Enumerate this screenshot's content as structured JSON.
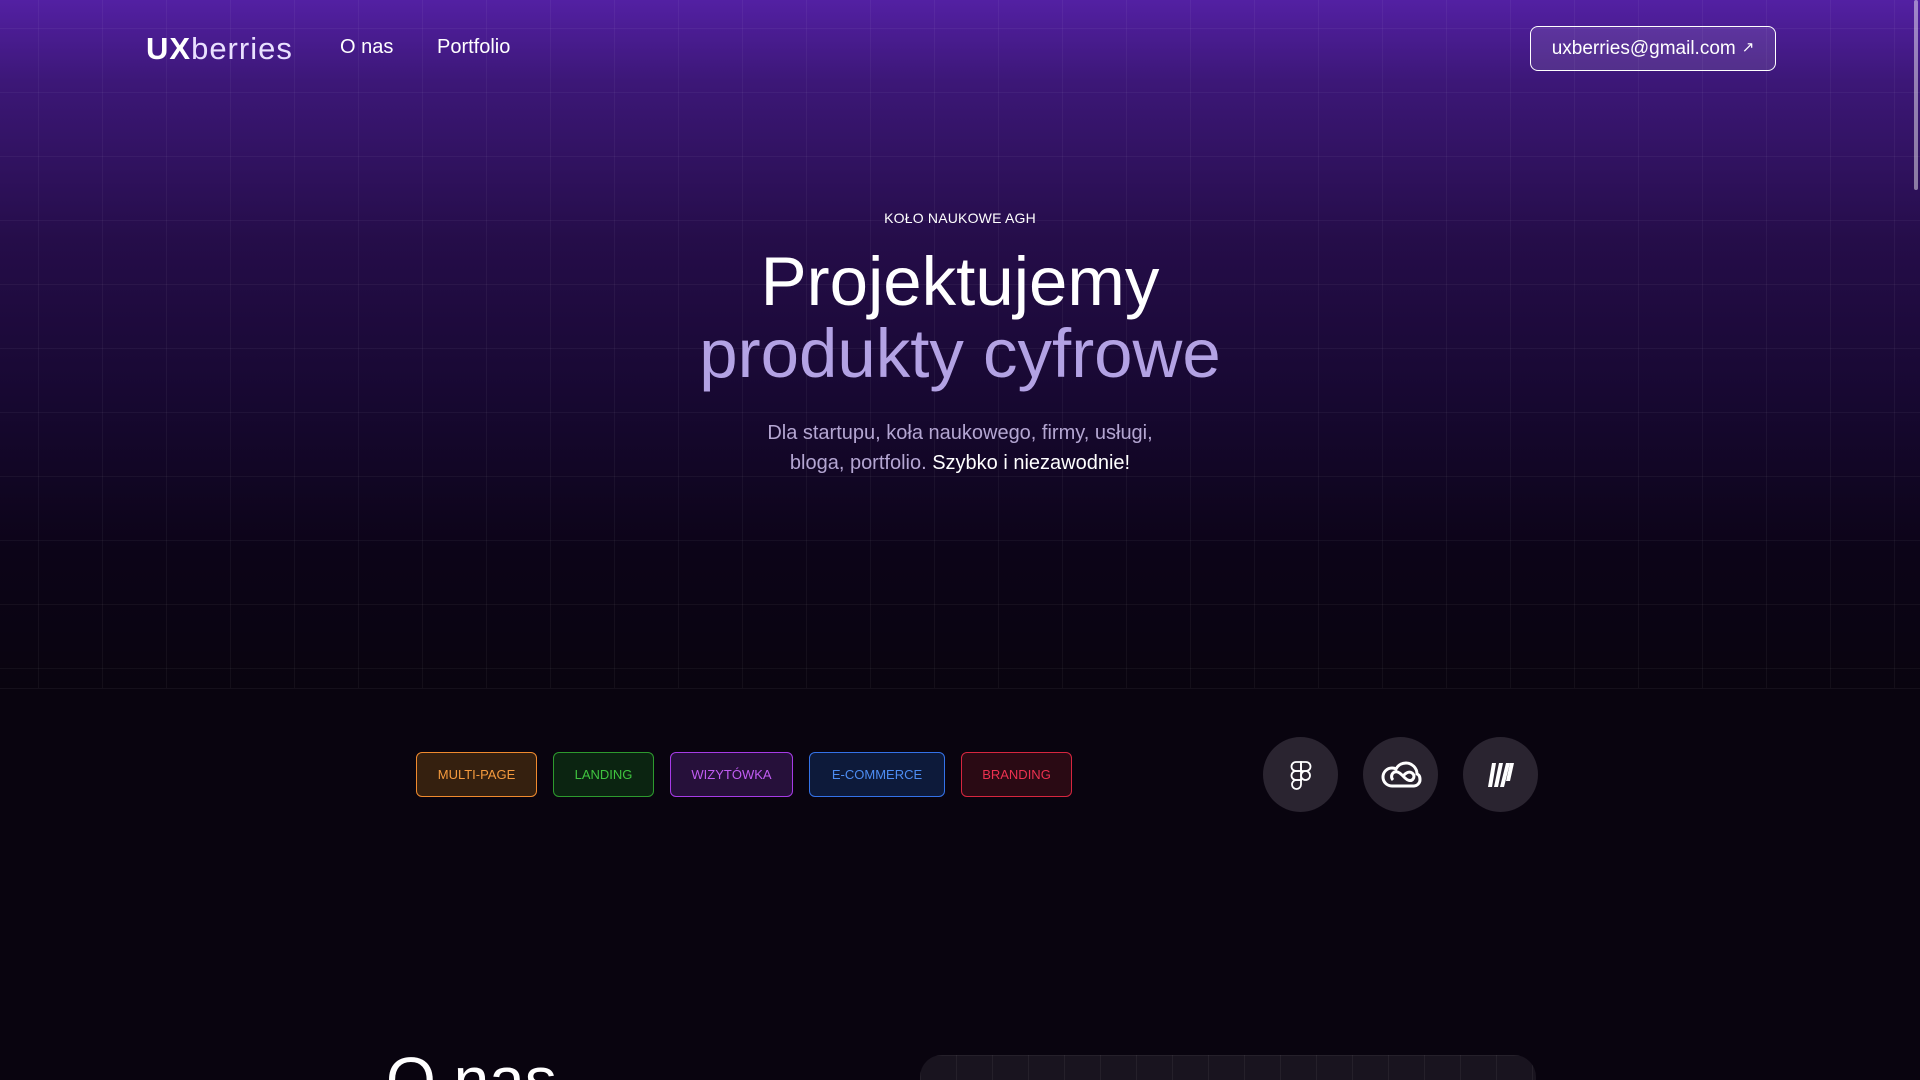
{
  "nav": {
    "logo_ux": "UX",
    "logo_berries": "berries",
    "links": [
      {
        "label": "O nas"
      },
      {
        "label": "Portfolio"
      }
    ],
    "email_label": "uxberries@gmail.com",
    "email_arrow": "↗"
  },
  "hero": {
    "eyebrow": "KOŁO NAUKOWE AGH",
    "title_line1": "Projektujemy",
    "title_line2": "produkty cyfrowe",
    "subtitle_line1": "Dla startupu, koła naukowego, firmy, usługi,",
    "subtitle_line2_part1": "bloga, portfolio.",
    "subtitle_line2_part2": "Szybko i niezawodnie!"
  },
  "tags": [
    {
      "label": "MULTI-PAGE",
      "color": "#f59a3d"
    },
    {
      "label": "LANDING",
      "color": "#3fc33f"
    },
    {
      "label": "WIZYTÓWKA",
      "color": "#c15cf3"
    },
    {
      "label": "E-COMMERCE",
      "color": "#4d8df3"
    },
    {
      "label": "BRANDING",
      "color": "#ec3150"
    }
  ],
  "tools": [
    {
      "icon": "figma-icon"
    },
    {
      "icon": "creative-cloud-icon"
    },
    {
      "icon": "miro-icon"
    }
  ],
  "about": {
    "title": "O nas"
  },
  "colors": {
    "hero_top": "#5320a3",
    "background": "#09040f",
    "accent_text": "#b3a2e4"
  }
}
